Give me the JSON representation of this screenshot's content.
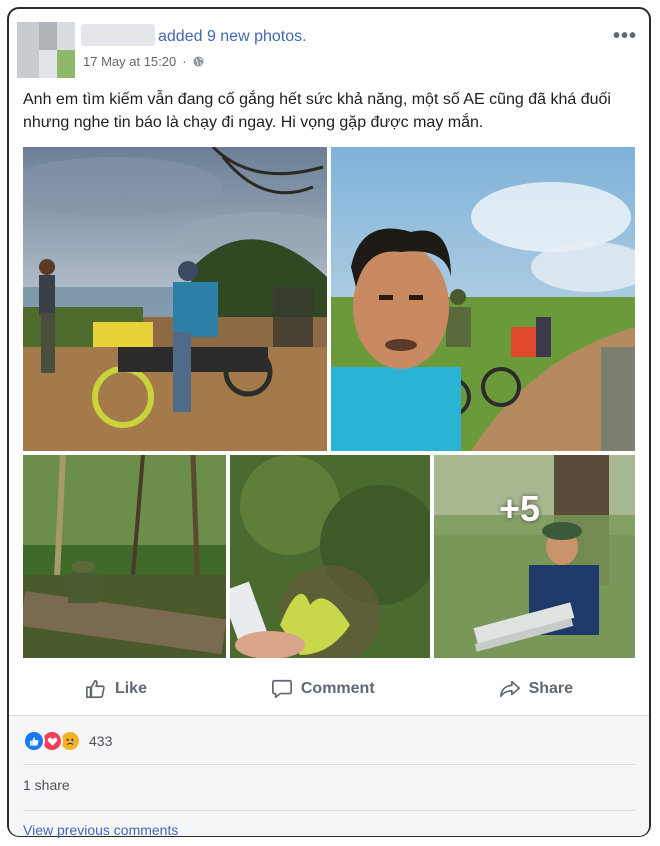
{
  "post": {
    "headline_action": "added 9 new photos.",
    "timestamp": "17 May at 15:20",
    "dot": "·",
    "more_label": "•••",
    "text": "Anh em tìm kiếm vẫn đang cố gắng hết sức khả năng, một số AE cũng đã khá đuối nhưng nghe tin báo là chạy đi ngay. Hi vọng gặp được may mắn.",
    "more_photos": "+5"
  },
  "actions": {
    "like": "Like",
    "comment": "Comment",
    "share": "Share"
  },
  "footer": {
    "reaction_count": "433",
    "shares": "1 share",
    "view_previous": "View previous comments"
  },
  "colors": {
    "link": "#4267b2",
    "like_blue": "#1877f2",
    "love_red": "#f33e58",
    "sad_yellow": "#f7b125"
  },
  "icons": [
    "globe-icon",
    "more-icon",
    "like-icon",
    "comment-icon",
    "share-icon",
    "like-reaction-icon",
    "love-reaction-icon",
    "sad-reaction-icon"
  ]
}
